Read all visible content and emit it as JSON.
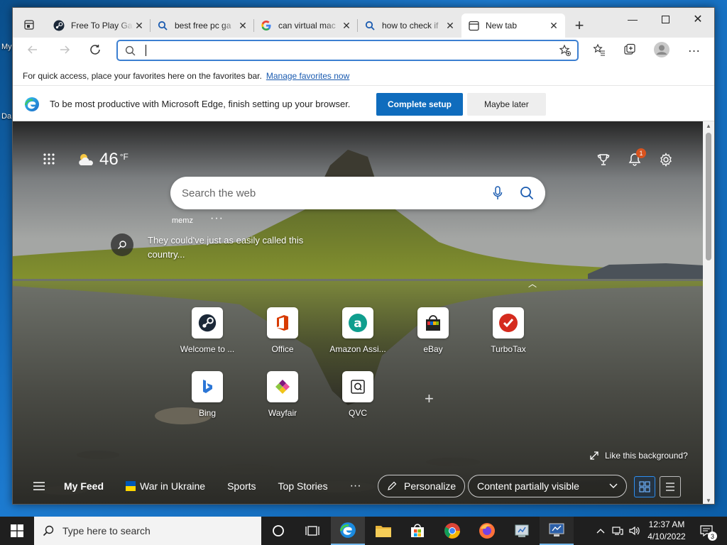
{
  "desktop": {
    "labels": [
      "My",
      "Da"
    ]
  },
  "tabs": [
    {
      "title": "Free To Play Ga",
      "icon": "steam-icon"
    },
    {
      "title": "best free pc ga",
      "icon": "search-icon"
    },
    {
      "title": "can virtual mac",
      "icon": "google-icon"
    },
    {
      "title": "how to check if",
      "icon": "search-icon"
    },
    {
      "title": "New tab",
      "icon": "newtab-icon"
    }
  ],
  "address_bar": {
    "value": "",
    "placeholder": ""
  },
  "favorites_bar": {
    "message": "For quick access, place your favorites here on the favorites bar.",
    "link": "Manage favorites now"
  },
  "setup_bar": {
    "message": "To be most productive with Microsoft Edge, finish setting up your browser.",
    "primary": "Complete setup",
    "secondary": "Maybe later"
  },
  "ntp": {
    "weather": {
      "temp": "46",
      "unit": "°F"
    },
    "search_placeholder": "Search the web",
    "account_label": "memz",
    "image_caption": "They could've just as easily called this country...",
    "quick_links": [
      {
        "label": "Welcome to ...",
        "icon": "steam-icon"
      },
      {
        "label": "Office",
        "icon": "office-icon"
      },
      {
        "label": "Amazon Assi...",
        "icon": "amazon-icon"
      },
      {
        "label": "eBay",
        "icon": "ebay-icon"
      },
      {
        "label": "TurboTax",
        "icon": "turbotax-icon"
      },
      {
        "label": "Bing",
        "icon": "bing-icon"
      },
      {
        "label": "Wayfair",
        "icon": "wayfair-icon"
      },
      {
        "label": "QVC",
        "icon": "qvc-icon"
      }
    ],
    "like_background": "Like this background?",
    "notification_count": "1",
    "feed": {
      "items": [
        "My Feed",
        "War in Ukraine",
        "Sports",
        "Top Stories"
      ],
      "personalize": "Personalize",
      "content_visibility": "Content partially visible"
    }
  },
  "taskbar": {
    "search_placeholder": "Type here to search",
    "time": "12:37 AM",
    "date": "4/10/2022",
    "notification_count": "3"
  }
}
